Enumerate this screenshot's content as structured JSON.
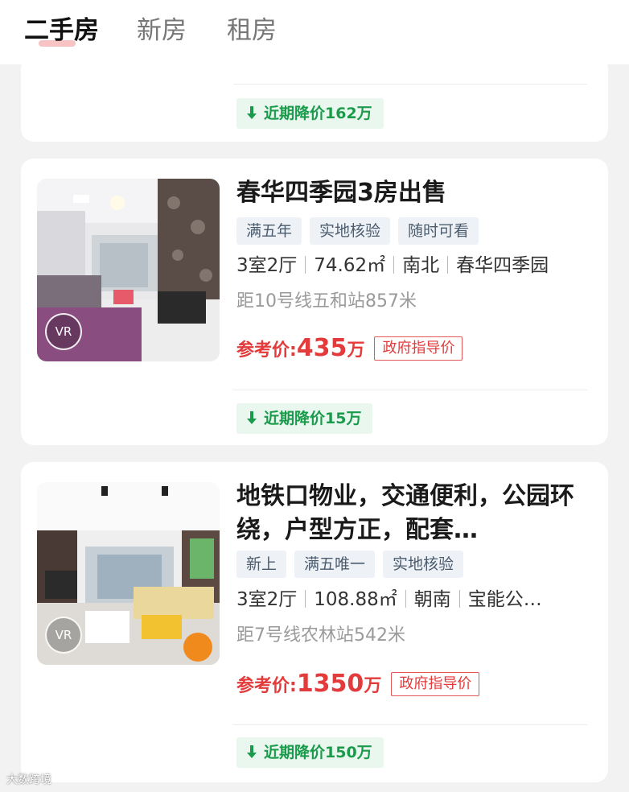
{
  "tabs": [
    {
      "label": "二手房",
      "active": true
    },
    {
      "label": "新房",
      "active": false
    },
    {
      "label": "租房",
      "active": false
    }
  ],
  "listings": [
    {
      "price_drop": "近期降价162万"
    },
    {
      "title": "春华四季园3房出售",
      "tags": [
        "满五年",
        "实地核验",
        "随时可看"
      ],
      "layout": "3室2厅",
      "area": "74.62㎡",
      "orientation": "南北",
      "community": "春华四季园",
      "distance": "距10号线五和站857米",
      "price_label": "参考价:",
      "price_value": "435",
      "price_unit": "万",
      "gov_badge": "政府指导价",
      "vr_label": "VR",
      "price_drop": "近期降价15万"
    },
    {
      "title": "地铁口物业，交通便利，公园环绕，户型方正，配套…",
      "tags": [
        "新上",
        "满五唯一",
        "实地核验"
      ],
      "layout": "3室2厅",
      "area": "108.88㎡",
      "orientation": "朝南",
      "community": "宝能公…",
      "distance": "距7号线农林站542米",
      "price_label": "参考价:",
      "price_value": "1350",
      "price_unit": "万",
      "gov_badge": "政府指导价",
      "vr_label": "VR",
      "price_drop": "近期降价150万"
    }
  ],
  "watermark": "大数跨境",
  "colors": {
    "price_red": "#e33b3b",
    "drop_green": "#1a9b4b",
    "drop_bg": "#e9f7ee",
    "tag_bg": "#eef2f6"
  }
}
